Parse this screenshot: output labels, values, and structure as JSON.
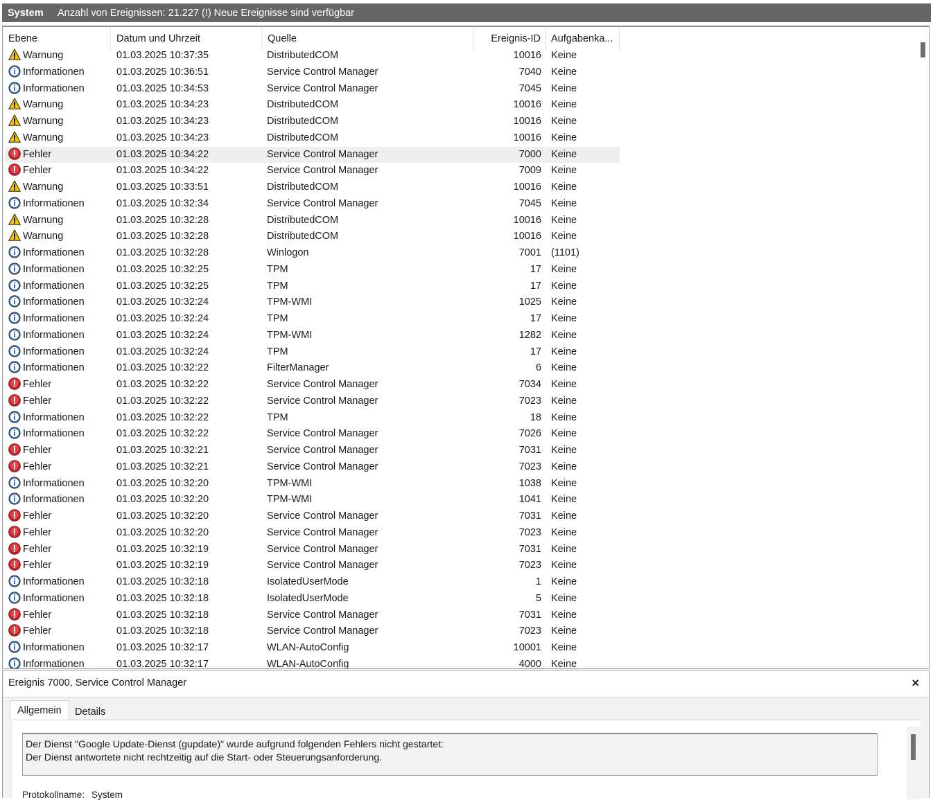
{
  "topbar": {
    "title": "System",
    "status": "Anzahl von Ereignissen: 21.227 (!) Neue Ereignisse sind verfügbar"
  },
  "list": {
    "columns": [
      {
        "key": "level",
        "label": "Ebene"
      },
      {
        "key": "date",
        "label": "Datum und Uhrzeit"
      },
      {
        "key": "source",
        "label": "Quelle"
      },
      {
        "key": "id",
        "label": "Ereignis-ID"
      },
      {
        "key": "task",
        "label": "Aufgabenka..."
      }
    ],
    "selected_index": 6,
    "rows": [
      {
        "level": "Warnung",
        "icon": "warning-icon",
        "date": "01.03.2025 10:37:35",
        "source": "DistributedCOM",
        "id": "10016",
        "task": "Keine"
      },
      {
        "level": "Informationen",
        "icon": "info-icon",
        "date": "01.03.2025 10:36:51",
        "source": "Service Control Manager",
        "id": "7040",
        "task": "Keine"
      },
      {
        "level": "Informationen",
        "icon": "info-icon",
        "date": "01.03.2025 10:34:53",
        "source": "Service Control Manager",
        "id": "7045",
        "task": "Keine"
      },
      {
        "level": "Warnung",
        "icon": "warning-icon",
        "date": "01.03.2025 10:34:23",
        "source": "DistributedCOM",
        "id": "10016",
        "task": "Keine"
      },
      {
        "level": "Warnung",
        "icon": "warning-icon",
        "date": "01.03.2025 10:34:23",
        "source": "DistributedCOM",
        "id": "10016",
        "task": "Keine"
      },
      {
        "level": "Warnung",
        "icon": "warning-icon",
        "date": "01.03.2025 10:34:23",
        "source": "DistributedCOM",
        "id": "10016",
        "task": "Keine"
      },
      {
        "level": "Fehler",
        "icon": "error-icon",
        "date": "01.03.2025 10:34:22",
        "source": "Service Control Manager",
        "id": "7000",
        "task": "Keine"
      },
      {
        "level": "Fehler",
        "icon": "error-icon",
        "date": "01.03.2025 10:34:22",
        "source": "Service Control Manager",
        "id": "7009",
        "task": "Keine"
      },
      {
        "level": "Warnung",
        "icon": "warning-icon",
        "date": "01.03.2025 10:33:51",
        "source": "DistributedCOM",
        "id": "10016",
        "task": "Keine"
      },
      {
        "level": "Informationen",
        "icon": "info-icon",
        "date": "01.03.2025 10:32:34",
        "source": "Service Control Manager",
        "id": "7045",
        "task": "Keine"
      },
      {
        "level": "Warnung",
        "icon": "warning-icon",
        "date": "01.03.2025 10:32:28",
        "source": "DistributedCOM",
        "id": "10016",
        "task": "Keine"
      },
      {
        "level": "Warnung",
        "icon": "warning-icon",
        "date": "01.03.2025 10:32:28",
        "source": "DistributedCOM",
        "id": "10016",
        "task": "Keine"
      },
      {
        "level": "Informationen",
        "icon": "info-icon",
        "date": "01.03.2025 10:32:28",
        "source": "Winlogon",
        "id": "7001",
        "task": "(1101)"
      },
      {
        "level": "Informationen",
        "icon": "info-icon",
        "date": "01.03.2025 10:32:25",
        "source": "TPM",
        "id": "17",
        "task": "Keine"
      },
      {
        "level": "Informationen",
        "icon": "info-icon",
        "date": "01.03.2025 10:32:25",
        "source": "TPM",
        "id": "17",
        "task": "Keine"
      },
      {
        "level": "Informationen",
        "icon": "info-icon",
        "date": "01.03.2025 10:32:24",
        "source": "TPM-WMI",
        "id": "1025",
        "task": "Keine"
      },
      {
        "level": "Informationen",
        "icon": "info-icon",
        "date": "01.03.2025 10:32:24",
        "source": "TPM",
        "id": "17",
        "task": "Keine"
      },
      {
        "level": "Informationen",
        "icon": "info-icon",
        "date": "01.03.2025 10:32:24",
        "source": "TPM-WMI",
        "id": "1282",
        "task": "Keine"
      },
      {
        "level": "Informationen",
        "icon": "info-icon",
        "date": "01.03.2025 10:32:24",
        "source": "TPM",
        "id": "17",
        "task": "Keine"
      },
      {
        "level": "Informationen",
        "icon": "info-icon",
        "date": "01.03.2025 10:32:22",
        "source": "FilterManager",
        "id": "6",
        "task": "Keine"
      },
      {
        "level": "Fehler",
        "icon": "error-icon",
        "date": "01.03.2025 10:32:22",
        "source": "Service Control Manager",
        "id": "7034",
        "task": "Keine"
      },
      {
        "level": "Fehler",
        "icon": "error-icon",
        "date": "01.03.2025 10:32:22",
        "source": "Service Control Manager",
        "id": "7023",
        "task": "Keine"
      },
      {
        "level": "Informationen",
        "icon": "info-icon",
        "date": "01.03.2025 10:32:22",
        "source": "TPM",
        "id": "18",
        "task": "Keine"
      },
      {
        "level": "Informationen",
        "icon": "info-icon",
        "date": "01.03.2025 10:32:22",
        "source": "Service Control Manager",
        "id": "7026",
        "task": "Keine"
      },
      {
        "level": "Fehler",
        "icon": "error-icon",
        "date": "01.03.2025 10:32:21",
        "source": "Service Control Manager",
        "id": "7031",
        "task": "Keine"
      },
      {
        "level": "Fehler",
        "icon": "error-icon",
        "date": "01.03.2025 10:32:21",
        "source": "Service Control Manager",
        "id": "7023",
        "task": "Keine"
      },
      {
        "level": "Informationen",
        "icon": "info-icon",
        "date": "01.03.2025 10:32:20",
        "source": "TPM-WMI",
        "id": "1038",
        "task": "Keine"
      },
      {
        "level": "Informationen",
        "icon": "info-icon",
        "date": "01.03.2025 10:32:20",
        "source": "TPM-WMI",
        "id": "1041",
        "task": "Keine"
      },
      {
        "level": "Fehler",
        "icon": "error-icon",
        "date": "01.03.2025 10:32:20",
        "source": "Service Control Manager",
        "id": "7031",
        "task": "Keine"
      },
      {
        "level": "Fehler",
        "icon": "error-icon",
        "date": "01.03.2025 10:32:20",
        "source": "Service Control Manager",
        "id": "7023",
        "task": "Keine"
      },
      {
        "level": "Fehler",
        "icon": "error-icon",
        "date": "01.03.2025 10:32:19",
        "source": "Service Control Manager",
        "id": "7031",
        "task": "Keine"
      },
      {
        "level": "Fehler",
        "icon": "error-icon",
        "date": "01.03.2025 10:32:19",
        "source": "Service Control Manager",
        "id": "7023",
        "task": "Keine"
      },
      {
        "level": "Informationen",
        "icon": "info-icon",
        "date": "01.03.2025 10:32:18",
        "source": "IsolatedUserMode",
        "id": "1",
        "task": "Keine"
      },
      {
        "level": "Informationen",
        "icon": "info-icon",
        "date": "01.03.2025 10:32:18",
        "source": "IsolatedUserMode",
        "id": "5",
        "task": "Keine"
      },
      {
        "level": "Fehler",
        "icon": "error-icon",
        "date": "01.03.2025 10:32:18",
        "source": "Service Control Manager",
        "id": "7031",
        "task": "Keine"
      },
      {
        "level": "Fehler",
        "icon": "error-icon",
        "date": "01.03.2025 10:32:18",
        "source": "Service Control Manager",
        "id": "7023",
        "task": "Keine"
      },
      {
        "level": "Informationen",
        "icon": "info-icon",
        "date": "01.03.2025 10:32:17",
        "source": "WLAN-AutoConfig",
        "id": "10001",
        "task": "Keine"
      },
      {
        "level": "Informationen",
        "icon": "info-icon",
        "date": "01.03.2025 10:32:17",
        "source": "WLAN-AutoConfig",
        "id": "4000",
        "task": "Keine"
      }
    ]
  },
  "detail": {
    "title": "Ereignis 7000, Service Control Manager",
    "close_label": "×",
    "tabs": [
      "Allgemein",
      "Details"
    ],
    "message": "Der Dienst \"Google Update-Dienst (gupdate)\" wurde aufgrund folgenden Fehlers nicht gestartet:\nDer Dienst antwortete nicht rechtzeitig auf die Start- oder Steuerungsanforderung.",
    "fields": {
      "protokollname_label": "Protokollname:",
      "protokollname_value": "System"
    }
  },
  "colors": {
    "topbar_bg": "#666666",
    "selected_row_bg": "#efefef",
    "warning": "#f2c400",
    "error": "#d42a2a",
    "info": "#2b579a"
  }
}
